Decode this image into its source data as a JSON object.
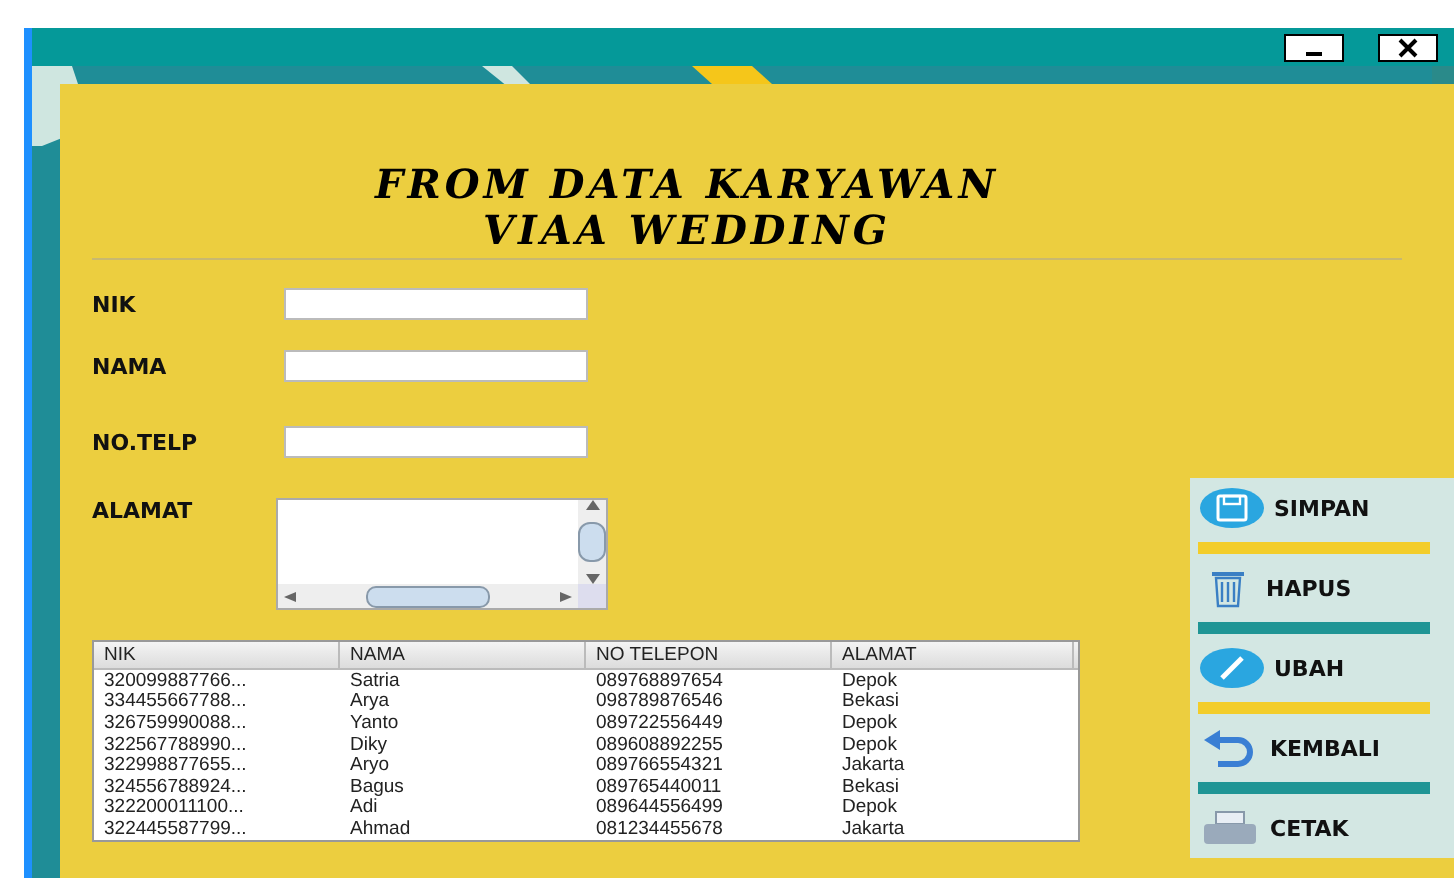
{
  "title_lines": [
    "FROM DATA KARYAWAN",
    "VIAA WEDDING"
  ],
  "form_fields": [
    {
      "label": "NIK",
      "kind": "text"
    },
    {
      "label": "NAMA",
      "kind": "text"
    },
    {
      "label": "NO.TELP",
      "kind": "text"
    },
    {
      "label": "ALAMAT",
      "kind": "textarea"
    }
  ],
  "table": {
    "columns": [
      "NIK",
      "NAMA",
      "NO TELEPON",
      "ALAMAT"
    ],
    "rows": [
      [
        "320099887766...",
        "Satria",
        "089768897654",
        "Depok"
      ],
      [
        "334455667788...",
        "Arya",
        "098789876546",
        "Bekasi"
      ],
      [
        "326759990088...",
        "Yanto",
        "089722556449",
        "Depok"
      ],
      [
        "322567788990...",
        "Diky",
        "089608892255",
        "Depok"
      ],
      [
        "322998877655...",
        "Aryo",
        "089766554321",
        "Jakarta"
      ],
      [
        "324556788924...",
        "Bagus",
        "089765440011",
        "Bekasi"
      ],
      [
        "322200011100...",
        "Adi",
        "089644556499",
        "Depok"
      ],
      [
        "322445587799...",
        "Ahmad",
        "081234455678",
        "Jakarta"
      ]
    ]
  },
  "buttons": [
    {
      "label": "SIMPAN",
      "kind": "save"
    },
    {
      "label": "HAPUS",
      "kind": "trash"
    },
    {
      "label": "UBAH",
      "kind": "edit"
    },
    {
      "label": "KEMBALI",
      "kind": "undo"
    },
    {
      "label": "CETAK",
      "kind": "print"
    }
  ]
}
